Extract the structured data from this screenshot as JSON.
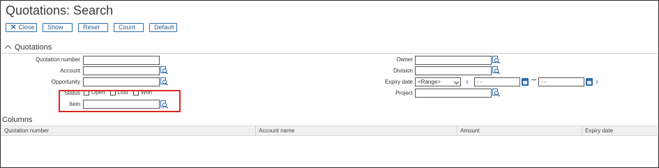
{
  "page": {
    "title": "Quotations: Search"
  },
  "toolbar": {
    "close_label": "Close",
    "show_label": "Show",
    "reset_label": "Reset",
    "count_label": "Count",
    "default_label": "Default"
  },
  "section": {
    "title": "Quotations"
  },
  "fields": {
    "quotation_number": {
      "label": "Quotation number",
      "value": ""
    },
    "account": {
      "label": "Account",
      "value": ""
    },
    "opportunity": {
      "label": "Opportunity",
      "value": ""
    },
    "status": {
      "label": "Status",
      "options": [
        "Open",
        "Lost",
        "Won"
      ]
    },
    "item": {
      "label": "Item",
      "value": ""
    },
    "owner": {
      "label": "Owner",
      "value": ""
    },
    "division": {
      "label": "Division",
      "value": ""
    },
    "expiry_date": {
      "label": "Expiry date",
      "range": "<Range>",
      "from": "- -",
      "to": "- -"
    },
    "project": {
      "label": "Project",
      "value": ""
    }
  },
  "columns": {
    "title": "Columns",
    "headers": [
      "Quotation number",
      "Account name",
      "Amount",
      "Expiry date"
    ]
  },
  "colors": {
    "accent": "#2d6aa9",
    "highlight": "#e02424"
  }
}
